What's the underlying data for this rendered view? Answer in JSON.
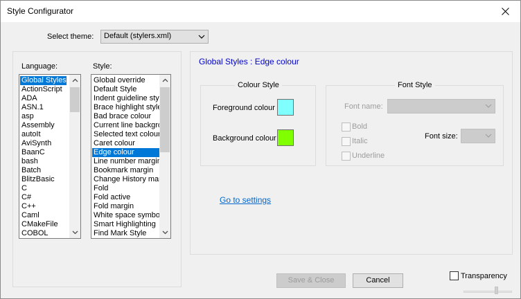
{
  "window": {
    "title": "Style Configurator",
    "close_glyph": "✕"
  },
  "theme": {
    "label": "Select theme:",
    "value": "Default (stylers.xml)"
  },
  "language": {
    "label": "Language:",
    "selected": "Global Styles",
    "items": [
      "Global Styles",
      "ActionScript",
      "ADA",
      "ASN.1",
      "asp",
      "Assembly",
      "autoIt",
      "AviSynth",
      "BaanC",
      "bash",
      "Batch",
      "BlitzBasic",
      "C",
      "C#",
      "C++",
      "Caml",
      "CMakeFile",
      "COBOL"
    ]
  },
  "style": {
    "label": "Style:",
    "selected": "Edge colour",
    "items": [
      "Global override",
      "Default Style",
      "Indent guideline style",
      "Brace highlight style",
      "Bad brace colour",
      "Current line background",
      "Selected text colour",
      "Caret colour",
      "Edge colour",
      "Line number margin",
      "Bookmark margin",
      "Change History margin",
      "Fold",
      "Fold active",
      "Fold margin",
      "White space symbol",
      "Smart Highlighting",
      "Find Mark Style"
    ]
  },
  "panel": {
    "heading": "Global Styles : Edge colour"
  },
  "colour_style": {
    "title": "Colour Style",
    "foreground_label": "Foreground colour",
    "foreground_color": "#80ffff",
    "background_label": "Background colour",
    "background_color": "#80ff00"
  },
  "font_style": {
    "title": "Font Style",
    "font_name_label": "Font name:",
    "font_name_value": "",
    "bold_label": "Bold",
    "italic_label": "Italic",
    "underline_label": "Underline",
    "font_size_label": "Font size:",
    "font_size_value": ""
  },
  "links": {
    "go_to_settings": "Go to settings"
  },
  "buttons": {
    "save_close": "Save & Close",
    "cancel": "Cancel"
  },
  "transparency": {
    "label": "Transparency",
    "checked": false
  },
  "colors": {
    "selection": "#0078d7",
    "heading": "#0000cc",
    "link": "#0066cc"
  }
}
